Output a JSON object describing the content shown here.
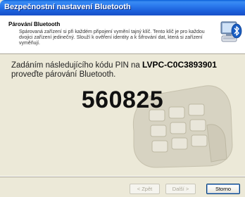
{
  "window": {
    "title": "Bezpečnostní nastavení Bluetooth"
  },
  "header": {
    "title": "Párování Bluetooth",
    "description": "Spárovaná zařízení si při každém připojení vymění tajný klíč. Tento klíč je pro každou dvojici zařízení jedinečný. Slouží k ověření identity a k šifrování dat, která si zařízení vyměňují.",
    "icon": "bluetooth-computer-icon"
  },
  "content": {
    "instruction_prefix": "Zadáním následujícího kódu PIN na ",
    "device_name": "LVPC-C0C3893901",
    "instruction_suffix": "proveďte párování Bluetooth.",
    "pin": "560825"
  },
  "buttons": {
    "back": "< Zpět",
    "next": "Další >",
    "cancel": "Storno"
  }
}
